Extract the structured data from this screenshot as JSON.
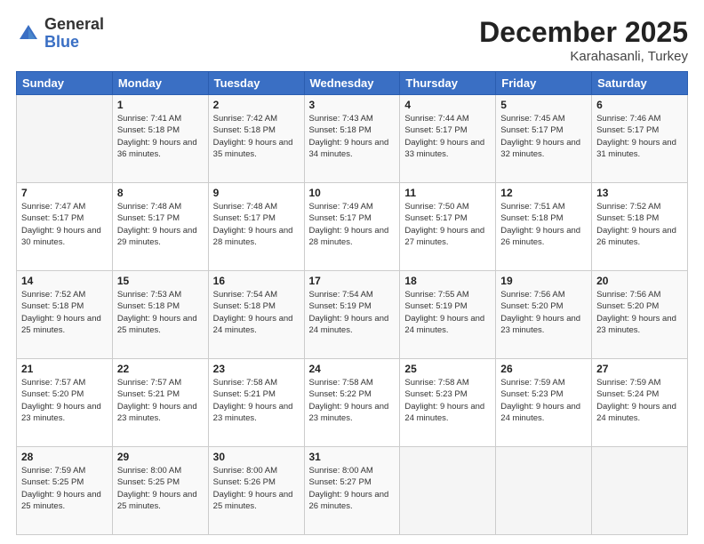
{
  "logo": {
    "general": "General",
    "blue": "Blue"
  },
  "header": {
    "month": "December 2025",
    "location": "Karahasanli, Turkey"
  },
  "weekdays": [
    "Sunday",
    "Monday",
    "Tuesday",
    "Wednesday",
    "Thursday",
    "Friday",
    "Saturday"
  ],
  "weeks": [
    [
      {
        "day": "",
        "sunrise": "",
        "sunset": "",
        "daylight": ""
      },
      {
        "day": "1",
        "sunrise": "Sunrise: 7:41 AM",
        "sunset": "Sunset: 5:18 PM",
        "daylight": "Daylight: 9 hours and 36 minutes."
      },
      {
        "day": "2",
        "sunrise": "Sunrise: 7:42 AM",
        "sunset": "Sunset: 5:18 PM",
        "daylight": "Daylight: 9 hours and 35 minutes."
      },
      {
        "day": "3",
        "sunrise": "Sunrise: 7:43 AM",
        "sunset": "Sunset: 5:18 PM",
        "daylight": "Daylight: 9 hours and 34 minutes."
      },
      {
        "day": "4",
        "sunrise": "Sunrise: 7:44 AM",
        "sunset": "Sunset: 5:17 PM",
        "daylight": "Daylight: 9 hours and 33 minutes."
      },
      {
        "day": "5",
        "sunrise": "Sunrise: 7:45 AM",
        "sunset": "Sunset: 5:17 PM",
        "daylight": "Daylight: 9 hours and 32 minutes."
      },
      {
        "day": "6",
        "sunrise": "Sunrise: 7:46 AM",
        "sunset": "Sunset: 5:17 PM",
        "daylight": "Daylight: 9 hours and 31 minutes."
      }
    ],
    [
      {
        "day": "7",
        "sunrise": "Sunrise: 7:47 AM",
        "sunset": "Sunset: 5:17 PM",
        "daylight": "Daylight: 9 hours and 30 minutes."
      },
      {
        "day": "8",
        "sunrise": "Sunrise: 7:48 AM",
        "sunset": "Sunset: 5:17 PM",
        "daylight": "Daylight: 9 hours and 29 minutes."
      },
      {
        "day": "9",
        "sunrise": "Sunrise: 7:48 AM",
        "sunset": "Sunset: 5:17 PM",
        "daylight": "Daylight: 9 hours and 28 minutes."
      },
      {
        "day": "10",
        "sunrise": "Sunrise: 7:49 AM",
        "sunset": "Sunset: 5:17 PM",
        "daylight": "Daylight: 9 hours and 28 minutes."
      },
      {
        "day": "11",
        "sunrise": "Sunrise: 7:50 AM",
        "sunset": "Sunset: 5:17 PM",
        "daylight": "Daylight: 9 hours and 27 minutes."
      },
      {
        "day": "12",
        "sunrise": "Sunrise: 7:51 AM",
        "sunset": "Sunset: 5:18 PM",
        "daylight": "Daylight: 9 hours and 26 minutes."
      },
      {
        "day": "13",
        "sunrise": "Sunrise: 7:52 AM",
        "sunset": "Sunset: 5:18 PM",
        "daylight": "Daylight: 9 hours and 26 minutes."
      }
    ],
    [
      {
        "day": "14",
        "sunrise": "Sunrise: 7:52 AM",
        "sunset": "Sunset: 5:18 PM",
        "daylight": "Daylight: 9 hours and 25 minutes."
      },
      {
        "day": "15",
        "sunrise": "Sunrise: 7:53 AM",
        "sunset": "Sunset: 5:18 PM",
        "daylight": "Daylight: 9 hours and 25 minutes."
      },
      {
        "day": "16",
        "sunrise": "Sunrise: 7:54 AM",
        "sunset": "Sunset: 5:18 PM",
        "daylight": "Daylight: 9 hours and 24 minutes."
      },
      {
        "day": "17",
        "sunrise": "Sunrise: 7:54 AM",
        "sunset": "Sunset: 5:19 PM",
        "daylight": "Daylight: 9 hours and 24 minutes."
      },
      {
        "day": "18",
        "sunrise": "Sunrise: 7:55 AM",
        "sunset": "Sunset: 5:19 PM",
        "daylight": "Daylight: 9 hours and 24 minutes."
      },
      {
        "day": "19",
        "sunrise": "Sunrise: 7:56 AM",
        "sunset": "Sunset: 5:20 PM",
        "daylight": "Daylight: 9 hours and 23 minutes."
      },
      {
        "day": "20",
        "sunrise": "Sunrise: 7:56 AM",
        "sunset": "Sunset: 5:20 PM",
        "daylight": "Daylight: 9 hours and 23 minutes."
      }
    ],
    [
      {
        "day": "21",
        "sunrise": "Sunrise: 7:57 AM",
        "sunset": "Sunset: 5:20 PM",
        "daylight": "Daylight: 9 hours and 23 minutes."
      },
      {
        "day": "22",
        "sunrise": "Sunrise: 7:57 AM",
        "sunset": "Sunset: 5:21 PM",
        "daylight": "Daylight: 9 hours and 23 minutes."
      },
      {
        "day": "23",
        "sunrise": "Sunrise: 7:58 AM",
        "sunset": "Sunset: 5:21 PM",
        "daylight": "Daylight: 9 hours and 23 minutes."
      },
      {
        "day": "24",
        "sunrise": "Sunrise: 7:58 AM",
        "sunset": "Sunset: 5:22 PM",
        "daylight": "Daylight: 9 hours and 23 minutes."
      },
      {
        "day": "25",
        "sunrise": "Sunrise: 7:58 AM",
        "sunset": "Sunset: 5:23 PM",
        "daylight": "Daylight: 9 hours and 24 minutes."
      },
      {
        "day": "26",
        "sunrise": "Sunrise: 7:59 AM",
        "sunset": "Sunset: 5:23 PM",
        "daylight": "Daylight: 9 hours and 24 minutes."
      },
      {
        "day": "27",
        "sunrise": "Sunrise: 7:59 AM",
        "sunset": "Sunset: 5:24 PM",
        "daylight": "Daylight: 9 hours and 24 minutes."
      }
    ],
    [
      {
        "day": "28",
        "sunrise": "Sunrise: 7:59 AM",
        "sunset": "Sunset: 5:25 PM",
        "daylight": "Daylight: 9 hours and 25 minutes."
      },
      {
        "day": "29",
        "sunrise": "Sunrise: 8:00 AM",
        "sunset": "Sunset: 5:25 PM",
        "daylight": "Daylight: 9 hours and 25 minutes."
      },
      {
        "day": "30",
        "sunrise": "Sunrise: 8:00 AM",
        "sunset": "Sunset: 5:26 PM",
        "daylight": "Daylight: 9 hours and 25 minutes."
      },
      {
        "day": "31",
        "sunrise": "Sunrise: 8:00 AM",
        "sunset": "Sunset: 5:27 PM",
        "daylight": "Daylight: 9 hours and 26 minutes."
      },
      {
        "day": "",
        "sunrise": "",
        "sunset": "",
        "daylight": ""
      },
      {
        "day": "",
        "sunrise": "",
        "sunset": "",
        "daylight": ""
      },
      {
        "day": "",
        "sunrise": "",
        "sunset": "",
        "daylight": ""
      }
    ]
  ]
}
